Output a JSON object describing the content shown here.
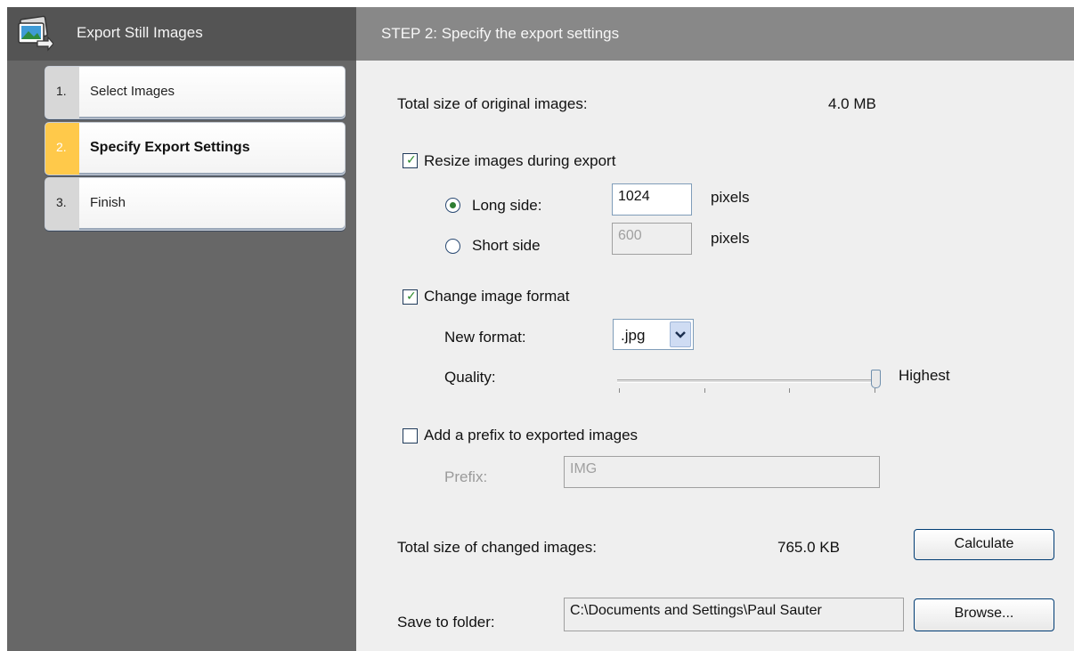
{
  "app": {
    "title": "Export Still Images",
    "icon": "export-images-icon"
  },
  "steps": [
    {
      "number": "1.",
      "label": "Select Images",
      "active": false
    },
    {
      "number": "2.",
      "label": "Specify Export Settings",
      "active": true
    },
    {
      "number": "3.",
      "label": "Finish",
      "active": false
    }
  ],
  "header": {
    "title": "STEP 2: Specify the export settings"
  },
  "original_size": {
    "label": "Total size of original images:",
    "value": "4.0 MB"
  },
  "resize": {
    "label": "Resize images during export",
    "checked": true,
    "long_side": {
      "label": "Long side:",
      "value": "1024",
      "unit": "pixels",
      "selected": true
    },
    "short_side": {
      "label": "Short side",
      "value": "600",
      "unit": "pixels",
      "selected": false
    }
  },
  "format": {
    "label": "Change image format",
    "checked": true,
    "new_format_label": "New format:",
    "selected_format": ".jpg",
    "quality_label": "Quality:",
    "quality_value_label": "Highest",
    "quality_level": 1.0
  },
  "prefix": {
    "label": "Add a prefix to exported images",
    "checked": false,
    "field_label": "Prefix:",
    "value": "IMG"
  },
  "changed_size": {
    "label": "Total size of changed images:",
    "value": "765.0 KB",
    "calculate_label": "Calculate"
  },
  "folder": {
    "label": "Save to folder:",
    "value": "C:\\Documents and Settings\\Paul Sauter",
    "browse_label": "Browse..."
  },
  "colors": {
    "active_step": "#ffc94a",
    "left_bg": "#676767",
    "right_bg": "#efefef"
  }
}
